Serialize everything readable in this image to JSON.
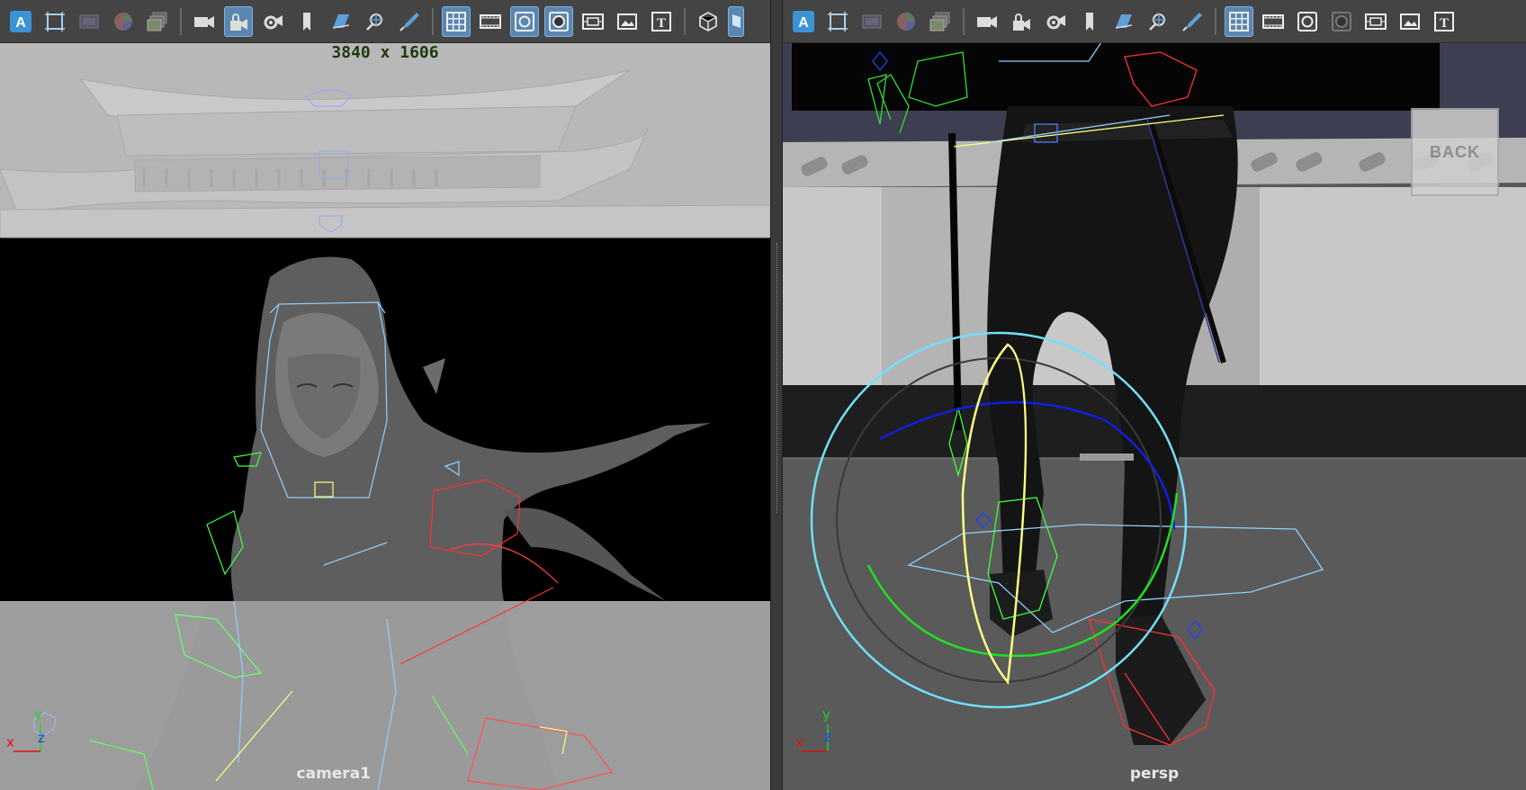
{
  "left_viewport": {
    "resolution": "3840 x 1606",
    "camera_label": "camera1",
    "axis": {
      "y": "y",
      "z": "z",
      "x": "x"
    }
  },
  "right_viewport": {
    "camera_label": "persp",
    "back_button": "BACK",
    "axis": {
      "y": "y",
      "z": "z",
      "x": "x"
    }
  },
  "toolbar": {
    "text_icon": "T",
    "app_icon": "A"
  },
  "icons": {
    "toolbar_left": [
      "app-logo-icon",
      "camera-frame-icon",
      "film-gate-icon",
      "color-wheel-icon",
      "image-stack-icon",
      "camera-icon",
      "camera-lock-icon",
      "camera-settings-icon",
      "bookmark-icon",
      "plane-icon",
      "pivot-icon",
      "paint-brush-icon",
      "grid-icon",
      "film-strip-icon",
      "resolution-gate-icon",
      "safe-frame-icon",
      "field-chart-icon",
      "image-plane-icon",
      "text-icon",
      "cube-icon"
    ],
    "toolbar_right": [
      "app-logo-icon",
      "camera-frame-icon",
      "film-gate-icon",
      "color-wheel-icon",
      "image-stack-icon",
      "camera-icon",
      "camera-lock-icon",
      "camera-settings-icon",
      "bookmark-icon",
      "plane-icon",
      "pivot-icon",
      "paint-brush-icon",
      "grid-icon",
      "film-strip-icon",
      "resolution-gate-icon",
      "safe-frame-icon",
      "field-chart-icon",
      "image-plane-icon",
      "text-icon"
    ]
  },
  "colors": {
    "toolbar_bg": "#444444",
    "active_toggle": "#5a86b0",
    "resolution_text": "#1e3a12",
    "axis_x": "#e01010",
    "axis_y": "#20d020",
    "axis_z": "#2040ff"
  }
}
